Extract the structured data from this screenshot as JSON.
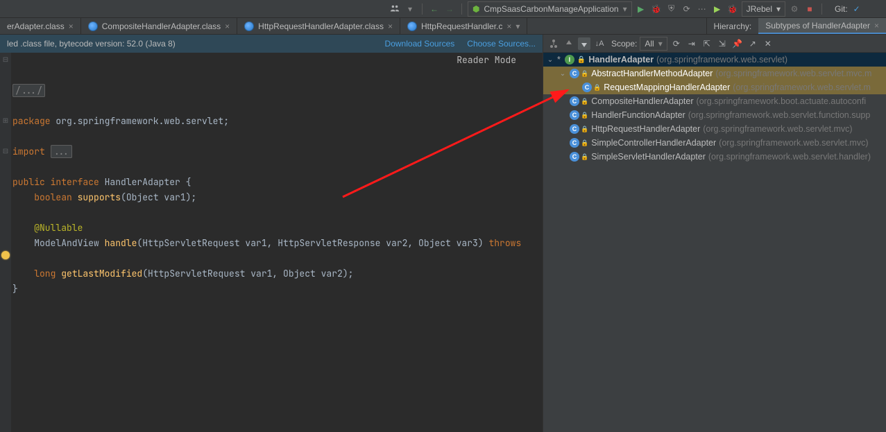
{
  "toolbar": {
    "run_config": "CmpSaasCarbonManageApplication",
    "jrebel": "JRebel",
    "git_label": "Git:"
  },
  "tabs": [
    {
      "label": "erAdapter.class",
      "active": false
    },
    {
      "label": "CompositeHandlerAdapter.class",
      "active": false
    },
    {
      "label": "HttpRequestHandlerAdapter.class",
      "active": false
    },
    {
      "label": "HttpRequestHandler.c",
      "active": false,
      "truncated": true
    }
  ],
  "hierarchy_tab": {
    "prefix": "Hierarchy:",
    "title": "Subtypes of HandlerAdapter"
  },
  "banner": {
    "text": "led .class file, bytecode version: 52.0 (Java 8)",
    "link1": "Download Sources",
    "link2": "Choose Sources..."
  },
  "reader_mode": "Reader Mode",
  "code": {
    "fold_marker": "/.../",
    "pkg_kw": "package",
    "pkg_val": " org.springframework.web.servlet;",
    "import_kw": "import",
    "import_fold": "...",
    "public": "public",
    "interface": "interface",
    "cls_name": " HandlerAdapter ",
    "brace_o": "{",
    "boolean": "boolean",
    "supports": "supports",
    "supports_args": "(Object var1);",
    "ann_nullable": "@Nullable",
    "mav": "    ModelAndView ",
    "handle": "handle",
    "handle_args": "(HttpServletRequest var1, HttpServletResponse var2, Object var3) ",
    "throws": "throws",
    "long": "long",
    "glm": "getLastModified",
    "glm_args": "(HttpServletRequest var1, Object var2);",
    "brace_c": "}"
  },
  "scope": {
    "label": "Scope:",
    "value": "All"
  },
  "tree": [
    {
      "depth": 0,
      "exp": "v",
      "ast": true,
      "icon": "int",
      "name": "HandlerAdapter",
      "pkg": "(org.springframework.web.servlet)",
      "sel": true
    },
    {
      "depth": 1,
      "exp": "v",
      "icon": "cls",
      "lock": true,
      "name": "AbstractHandlerMethodAdapter",
      "pkg": "(org.springframework.web.servlet.mvc.m",
      "hl": true
    },
    {
      "depth": 2,
      "exp": "",
      "icon": "cls",
      "lock": true,
      "name": "RequestMappingHandlerAdapter",
      "pkg": "(org.springframework.web.servlet.m",
      "hl": true
    },
    {
      "depth": 1,
      "exp": "",
      "icon": "cls",
      "lock": true,
      "name": "CompositeHandlerAdapter",
      "pkg": "(org.springframework.boot.actuate.autoconfi"
    },
    {
      "depth": 1,
      "exp": "",
      "icon": "cls",
      "lock": true,
      "name": "HandlerFunctionAdapter",
      "pkg": "(org.springframework.web.servlet.function.supp"
    },
    {
      "depth": 1,
      "exp": "",
      "icon": "cls",
      "lock": true,
      "name": "HttpRequestHandlerAdapter",
      "pkg": "(org.springframework.web.servlet.mvc)"
    },
    {
      "depth": 1,
      "exp": "",
      "icon": "cls",
      "lock": true,
      "name": "SimpleControllerHandlerAdapter",
      "pkg": "(org.springframework.web.servlet.mvc)"
    },
    {
      "depth": 1,
      "exp": "",
      "icon": "cls",
      "lock": true,
      "name": "SimpleServletHandlerAdapter",
      "pkg": "(org.springframework.web.servlet.handler)"
    }
  ]
}
